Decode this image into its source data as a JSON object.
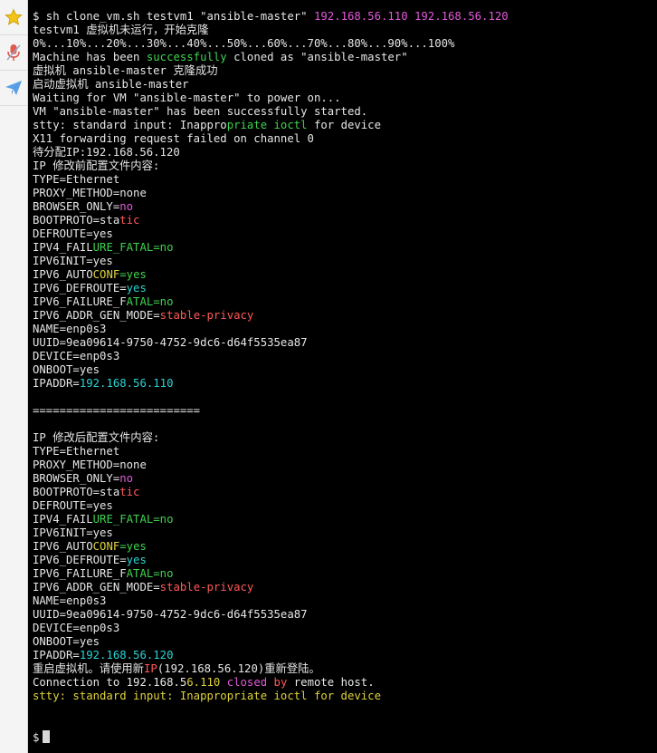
{
  "sidebar": {
    "items": [
      {
        "icon": "star-icon",
        "color": "#f2c418"
      },
      {
        "icon": "microphone-icon",
        "color": "#e05a4e"
      },
      {
        "icon": "paper-plane-icon",
        "color": "#4a90d9"
      }
    ]
  },
  "colors": {
    "background": "#000000",
    "text": "#e6e6e6",
    "magenta": "#e05ad8",
    "green": "#3fd24f",
    "red": "#ff5858",
    "cyan": "#2bd3d3",
    "yellow": "#e0d23c"
  },
  "terminal": {
    "lines": [
      [
        {
          "t": "$ sh clone_vm.sh testvm1 \"ansible-master\" "
        },
        {
          "t": "192.168.56.110 192.168.56.120",
          "c": "mag"
        }
      ],
      [
        {
          "t": "testvm1 虚拟机未运行，开始克隆"
        }
      ],
      [
        {
          "t": "0%...10%...20%...30%...40%...50%...60%...70%...80%...90%...100%"
        }
      ],
      [
        {
          "t": "Machine has been "
        },
        {
          "t": "successfully",
          "c": "grn"
        },
        {
          "t": " cloned as \"ansible-master\""
        }
      ],
      [
        {
          "t": "虚拟机 ansible-master 克隆成功"
        }
      ],
      [
        {
          "t": "启动虚拟机 ansible-master"
        }
      ],
      [
        {
          "t": "Waiting for VM \"ansible-master\" to power on..."
        }
      ],
      [
        {
          "t": "VM \"ansible-master\" has been successfully started."
        }
      ],
      [
        {
          "t": "stty: standard input: Inappro"
        },
        {
          "t": "priate ioctl",
          "c": "grn"
        },
        {
          "t": " for device"
        }
      ],
      [
        {
          "t": "X11 forwarding request failed on channel 0"
        }
      ],
      [
        {
          "t": "待分配IP:192.168.56.120"
        }
      ],
      [
        {
          "t": "IP 修改前配置文件内容:"
        }
      ],
      [
        {
          "t": "TYPE=Ethernet"
        }
      ],
      [
        {
          "t": "PROXY_METHOD=none"
        }
      ],
      [
        {
          "t": "BROWSER_ONLY="
        },
        {
          "t": "no",
          "c": "mag"
        }
      ],
      [
        {
          "t": "BOOTPROTO=sta"
        },
        {
          "t": "tic",
          "c": "red"
        }
      ],
      [
        {
          "t": "DEFROUTE=yes"
        }
      ],
      [
        {
          "t": "IPV4_FAIL"
        },
        {
          "t": "URE_FATAL=no",
          "c": "grn"
        }
      ],
      [
        {
          "t": "IPV6INIT=yes"
        }
      ],
      [
        {
          "t": "IPV6_AUTO"
        },
        {
          "t": "CONF",
          "c": "yel"
        },
        {
          "t": "=yes",
          "c": "grn"
        }
      ],
      [
        {
          "t": "IPV6_DEFROUTE="
        },
        {
          "t": "yes",
          "c": "cyn"
        }
      ],
      [
        {
          "t": "IPV6_FAILURE_F"
        },
        {
          "t": "ATAL=no",
          "c": "grn"
        }
      ],
      [
        {
          "t": "IPV6_ADDR_GEN_MODE="
        },
        {
          "t": "stable-privacy",
          "c": "red"
        }
      ],
      [
        {
          "t": "NAME=enp0s3"
        }
      ],
      [
        {
          "t": "UUID=9ea09614-9750-4752-9dc6-d64f5535ea87"
        }
      ],
      [
        {
          "t": "DEVICE=enp0s3"
        }
      ],
      [
        {
          "t": "ONBOOT=yes"
        }
      ],
      [
        {
          "t": "IPADDR="
        },
        {
          "t": "192.168.56.110",
          "c": "cyn"
        }
      ],
      [
        {
          "t": ""
        }
      ],
      [
        {
          "t": "========================="
        }
      ],
      [
        {
          "t": ""
        }
      ],
      [
        {
          "t": "IP 修改后配置文件内容:"
        }
      ],
      [
        {
          "t": "TYPE=Ethernet"
        }
      ],
      [
        {
          "t": "PROXY_METHOD=none"
        }
      ],
      [
        {
          "t": "BROWSER_ONLY="
        },
        {
          "t": "no",
          "c": "mag"
        }
      ],
      [
        {
          "t": "BOOTPROTO=sta"
        },
        {
          "t": "tic",
          "c": "red"
        }
      ],
      [
        {
          "t": "DEFROUTE=yes"
        }
      ],
      [
        {
          "t": "IPV4_FAIL"
        },
        {
          "t": "URE_FATAL=no",
          "c": "grn"
        }
      ],
      [
        {
          "t": "IPV6INIT=yes"
        }
      ],
      [
        {
          "t": "IPV6_AUTO"
        },
        {
          "t": "CONF",
          "c": "yel"
        },
        {
          "t": "=yes",
          "c": "grn"
        }
      ],
      [
        {
          "t": "IPV6_DEFROUTE="
        },
        {
          "t": "yes",
          "c": "cyn"
        }
      ],
      [
        {
          "t": "IPV6_FAILURE_F"
        },
        {
          "t": "ATAL=no",
          "c": "grn"
        }
      ],
      [
        {
          "t": "IPV6_ADDR_GEN_MODE="
        },
        {
          "t": "stable-privacy",
          "c": "red"
        }
      ],
      [
        {
          "t": "NAME=enp0s3"
        }
      ],
      [
        {
          "t": "UUID=9ea09614-9750-4752-9dc6-d64f5535ea87"
        }
      ],
      [
        {
          "t": "DEVICE=enp0s3"
        }
      ],
      [
        {
          "t": "ONBOOT=yes"
        }
      ],
      [
        {
          "t": "IPADDR="
        },
        {
          "t": "192.168.56.120",
          "c": "cyn"
        }
      ],
      [
        {
          "t": "重启虚拟机。请使用新"
        },
        {
          "t": "IP",
          "c": "red"
        },
        {
          "t": "(192.168.56.120)重新登陆。"
        }
      ],
      [
        {
          "t": "Connection to 192.168.5"
        },
        {
          "t": "6.110",
          "c": "yel"
        },
        {
          "t": " closed ",
          "c": "mag"
        },
        {
          "t": "by",
          "c": "red"
        },
        {
          "t": " remote host."
        }
      ],
      [
        {
          "t": "stty: standard input: ",
          "c": "yel"
        },
        {
          "t": "Inappropriate",
          "c": "yel"
        },
        {
          "t": " ioctl for device",
          "c": "yel"
        }
      ],
      [
        {
          "t": ""
        }
      ],
      [
        {
          "t": ""
        }
      ]
    ],
    "prompt": "$"
  }
}
